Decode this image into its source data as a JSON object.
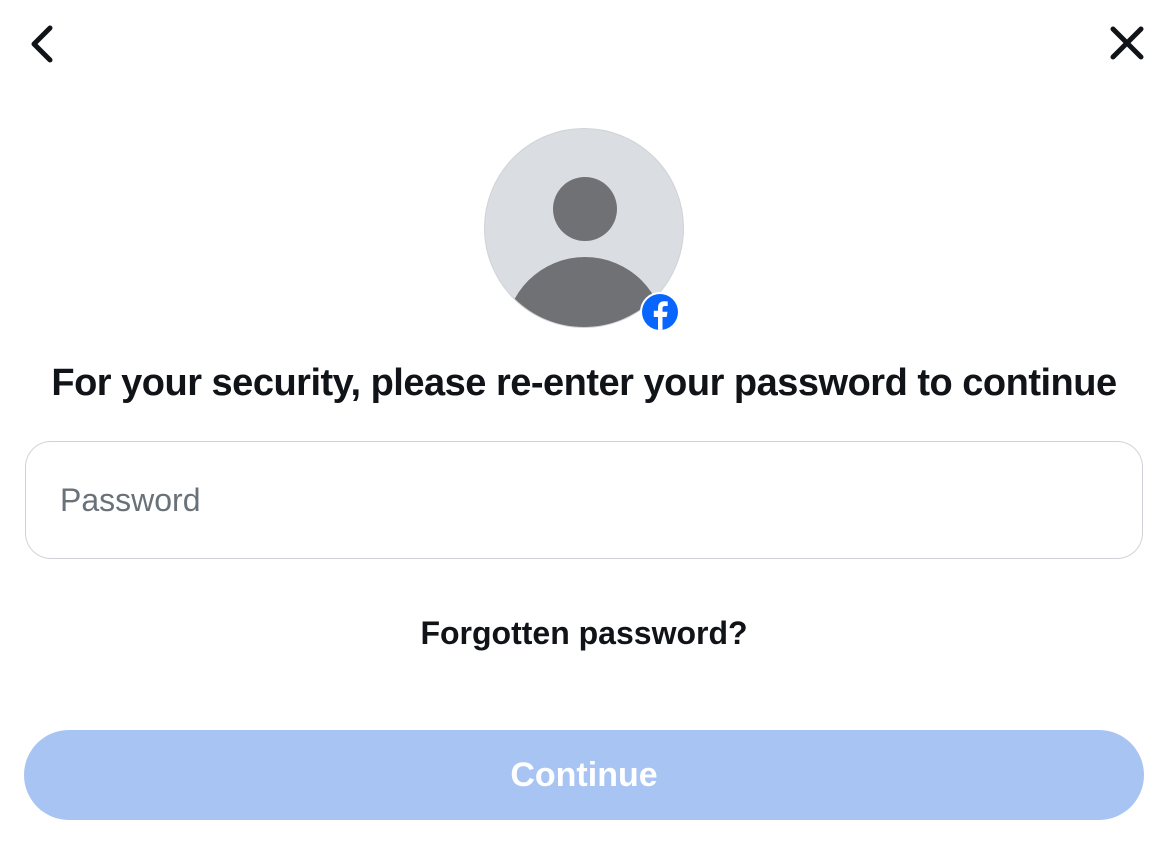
{
  "colors": {
    "accent": "#0866ff",
    "button_bg": "#a7c4f2",
    "button_text": "#ffffff",
    "avatar_bg": "#dadde1",
    "avatar_silhouette": "#6f7175",
    "text": "#101318",
    "placeholder": "#697179",
    "input_border": "#cfd3d8"
  },
  "header": {
    "back_icon": "chevron-left",
    "close_icon": "x"
  },
  "avatar": {
    "type": "default-silhouette",
    "badge_icon": "facebook-logo"
  },
  "heading": "For your security, please re-enter your password to continue",
  "password_field": {
    "placeholder": "Password",
    "value": ""
  },
  "forgot_link_label": "Forgotten password?",
  "continue_button_label": "Continue"
}
